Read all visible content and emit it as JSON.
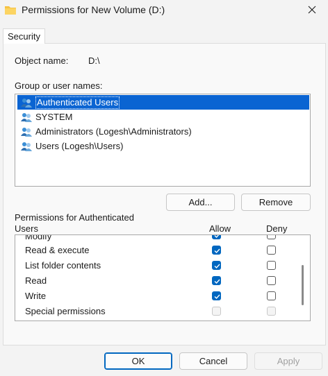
{
  "window": {
    "title": "Permissions for New Volume (D:)"
  },
  "tabs": [
    {
      "label": "Security"
    }
  ],
  "object": {
    "label": "Object name:",
    "value": "D:\\"
  },
  "groups": {
    "label": "Group or user names:",
    "items": [
      {
        "label": "Authenticated Users",
        "selected": true
      },
      {
        "label": "SYSTEM",
        "selected": false
      },
      {
        "label": "Administrators (Logesh\\Administrators)",
        "selected": false
      },
      {
        "label": "Users (Logesh\\Users)",
        "selected": false
      }
    ]
  },
  "buttons": {
    "add": "Add...",
    "remove": "Remove",
    "ok": "OK",
    "cancel": "Cancel",
    "apply": "Apply"
  },
  "permissions": {
    "header_line1": "Permissions for Authenticated",
    "header_line2": "Users",
    "allow_label": "Allow",
    "deny_label": "Deny",
    "partial_row": "Modify",
    "rows": [
      {
        "label": "Read & execute",
        "allow": "checked",
        "deny": "unchecked"
      },
      {
        "label": "List folder contents",
        "allow": "checked",
        "deny": "unchecked"
      },
      {
        "label": "Read",
        "allow": "checked",
        "deny": "unchecked"
      },
      {
        "label": "Write",
        "allow": "checked",
        "deny": "unchecked"
      },
      {
        "label": "Special permissions",
        "allow": "disabled",
        "deny": "disabled"
      }
    ]
  },
  "colors": {
    "accent": "#0067c0",
    "selection": "#0a64d2"
  }
}
